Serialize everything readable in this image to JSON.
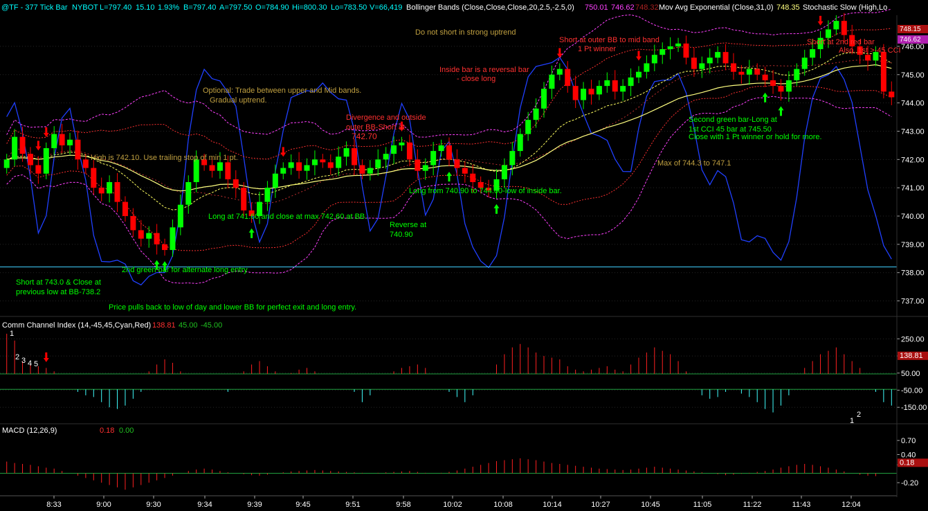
{
  "chart_data": [
    {
      "type": "candlestick",
      "header": {
        "symbol": "@TF - 377 Tick Bar",
        "exchange": "NYBOT",
        "last": "L=797.40",
        "net_change": "15.10",
        "pct_change": "1.93%",
        "bid": "B=797.40",
        "ask": "A=797.50",
        "open": "O=784.90",
        "high": "Hi=800.30",
        "low": "Lo=783.50",
        "volume": "V=66,419",
        "bb_label": "Bollinger Bands (Close,Close,Close,20,2.5,-2.5,0)",
        "bb_val1": "750.01",
        "bb_val2": "746.62",
        "bb_val3": "748.32",
        "ema_label": "Mov Avg Exponential (Close,31,0)",
        "ema_val": "748.35",
        "stoch_label": "Stochastic Slow (High,Lo"
      },
      "ylim": [
        736.5,
        747.1
      ],
      "y_ticks": [
        "737.00",
        "738.00",
        "739.00",
        "740.00",
        "741.00",
        "742.00",
        "743.00",
        "744.00",
        "745.00",
        "746.00"
      ],
      "price_tags": [
        "748.15",
        "746.62"
      ],
      "horizontal_line": 738.2,
      "x_ticks": [
        "8:33",
        "9:00",
        "9:30",
        "9:34",
        "9:39",
        "9:45",
        "9:51",
        "9:58",
        "10:02",
        "10:08",
        "10:14",
        "10:27",
        "10:45",
        "11:05",
        "11:22",
        "11:43",
        "12:04"
      ],
      "bar_count": 111,
      "close": [
        742.0,
        742.8,
        742.2,
        741.8,
        741.5,
        742.4,
        742.9,
        742.5,
        742.7,
        742.0,
        741.7,
        741.0,
        740.8,
        741.2,
        740.5,
        740.0,
        739.5,
        739.2,
        739.4,
        739.0,
        738.8,
        739.6,
        740.4,
        741.2,
        742.0,
        741.8,
        741.6,
        741.9,
        741.3,
        741.0,
        740.2,
        740.0,
        740.5,
        741.0,
        741.5,
        741.7,
        741.9,
        741.6,
        741.8,
        742.0,
        741.9,
        741.7,
        742.1,
        742.4,
        741.8,
        741.5,
        741.7,
        742.0,
        742.2,
        742.5,
        742.6,
        742.0,
        741.6,
        741.8,
        742.3,
        742.5,
        742.0,
        741.7,
        741.5,
        741.2,
        741.0,
        740.9,
        741.3,
        741.8,
        742.3,
        742.9,
        743.4,
        743.8,
        744.5,
        745.0,
        745.2,
        744.6,
        744.1,
        744.5,
        744.3,
        744.6,
        744.8,
        744.4,
        744.6,
        744.9,
        745.1,
        745.4,
        745.7,
        745.9,
        746.0,
        746.1,
        745.6,
        745.2,
        745.4,
        745.6,
        745.8,
        745.4,
        745.1,
        745.0,
        745.2,
        745.0,
        744.8,
        744.6,
        744.4,
        744.8,
        745.2,
        745.6,
        745.9,
        746.3,
        746.6,
        746.9,
        746.4,
        746.0,
        745.7,
        745.5,
        745.8,
        744.4,
        744.2
      ],
      "annotations": [
        "Do not short in strong uptrend",
        "Optional: Trade between upper and Mid bands.",
        "Gradual uptrend.",
        "High is 742.10. Use trailing stop of min 1 pt.",
        "Divergence and outside",
        "outer BB-Short at",
        "742.70",
        "Inside bar is a reversal bar",
        "- close long",
        "Short at outer BB to mid band",
        "1 Pt winner",
        "Short at 2nd red bar",
        "Also, 1st >-45 CCI",
        "Long from 740.90 to 744.60-low of inside bar.",
        "Long at 741.60 and close at max 742.60 at BB.",
        "Reverse at",
        "740.90",
        "2nd green bar for alternate long entry",
        "Short at 743.0 & Close at",
        "previous low at BB-738.2",
        "Price pulls back to low of day and lower BB for perfect exit and long entry.",
        "Second green bar-Long at",
        "1st CCI 45 bar at  745.50",
        "Close with 1 Pt winner or hold for more.",
        "Max of 744.3 to 747.1"
      ]
    },
    {
      "type": "bar",
      "title": "Comm Channel Index (14,-45,45,Cyan,Red)",
      "values_label": [
        "138.81",
        "45.00",
        "-45.00"
      ],
      "y_ticks": [
        "250.00",
        "150.00",
        "50.00",
        "-50.00",
        "-150.00"
      ],
      "price_tag": "138.81",
      "ylim": [
        -230,
        300
      ],
      "levels": [
        45,
        -45
      ],
      "labels": [
        "1",
        "2",
        "3",
        "4",
        "5",
        "1",
        "2"
      ],
      "values": [
        280,
        240,
        120,
        100,
        90,
        80,
        60,
        40,
        -40,
        -60,
        -80,
        -90,
        -120,
        -150,
        -160,
        -140,
        -100,
        -60,
        60,
        100,
        130,
        110,
        60,
        40,
        20,
        0,
        -20,
        -30,
        -60,
        30,
        60,
        100,
        120,
        90,
        60,
        40,
        50,
        70,
        80,
        60,
        40,
        30,
        20,
        -40,
        -60,
        -120,
        -80,
        -40,
        30,
        60,
        80,
        90,
        100,
        80,
        40,
        -30,
        -60,
        -90,
        -120,
        -80,
        -40,
        40,
        100,
        160,
        200,
        220,
        200,
        170,
        150,
        140,
        130,
        90,
        70,
        60,
        70,
        80,
        90,
        70,
        60,
        100,
        140,
        170,
        200,
        180,
        160,
        120,
        60,
        -40,
        -80,
        -100,
        -90,
        -60,
        -40,
        -70,
        -90,
        -120,
        -160,
        -180,
        -140,
        -80,
        40,
        80,
        120,
        160,
        180,
        200,
        160,
        120,
        80,
        40,
        -60,
        -120,
        -140
      ],
      "cursor_label": "5"
    },
    {
      "type": "bar",
      "title": "MACD (12,26,9)",
      "values_label": [
        "0.18",
        "0.00"
      ],
      "y_ticks": [
        "0.70",
        "0.40",
        "0.18",
        "-0.20"
      ],
      "price_tag": "0.18",
      "ylim": [
        -0.42,
        0.82
      ],
      "values": [
        0.25,
        0.22,
        0.2,
        0.18,
        0.15,
        0.12,
        0.1,
        0.05,
        0.0,
        -0.05,
        -0.1,
        -0.15,
        -0.2,
        -0.25,
        -0.3,
        -0.35,
        -0.3,
        -0.25,
        -0.2,
        -0.15,
        -0.1,
        -0.05,
        0.0,
        0.05,
        0.08,
        0.1,
        0.08,
        0.05,
        0.02,
        0.0,
        -0.02,
        -0.04,
        -0.05,
        -0.03,
        0.0,
        0.02,
        0.04,
        0.05,
        0.06,
        0.07,
        0.06,
        0.05,
        0.04,
        0.03,
        0.02,
        0.01,
        0.0,
        0.01,
        0.02,
        0.03,
        0.04,
        0.05,
        0.03,
        0.01,
        0.0,
        0.01,
        0.03,
        0.06,
        0.1,
        0.14,
        0.18,
        0.22,
        0.26,
        0.28,
        0.3,
        0.32,
        0.3,
        0.28,
        0.25,
        0.22,
        0.2,
        0.18,
        0.16,
        0.14,
        0.12,
        0.1,
        0.09,
        0.08,
        0.07,
        0.08,
        0.1,
        0.12,
        0.14,
        0.12,
        0.1,
        0.08,
        0.06,
        0.04,
        0.02,
        0.0,
        -0.02,
        -0.04,
        -0.03,
        -0.01,
        0.01,
        0.03,
        0.05,
        0.08,
        0.12,
        0.15,
        0.18,
        0.2,
        0.18,
        0.15,
        0.12,
        0.08,
        0.04,
        0.0,
        -0.03,
        -0.05,
        -0.06
      ]
    }
  ],
  "colors": {
    "up": "#00ff00",
    "down": "#ff0000",
    "bollinger": "#ff3030",
    "bollinger_outer": "#ff40ff",
    "ema": "#ffff80",
    "stochastic": "#2040ff",
    "cci_pos": "#ff2020",
    "cci_neg": "#40ffff",
    "macd": "#ff2020",
    "grid": "#404040",
    "annotation_green": "#00ff00",
    "annotation_red": "#ff3030",
    "annotation_olive": "#c0a040"
  }
}
